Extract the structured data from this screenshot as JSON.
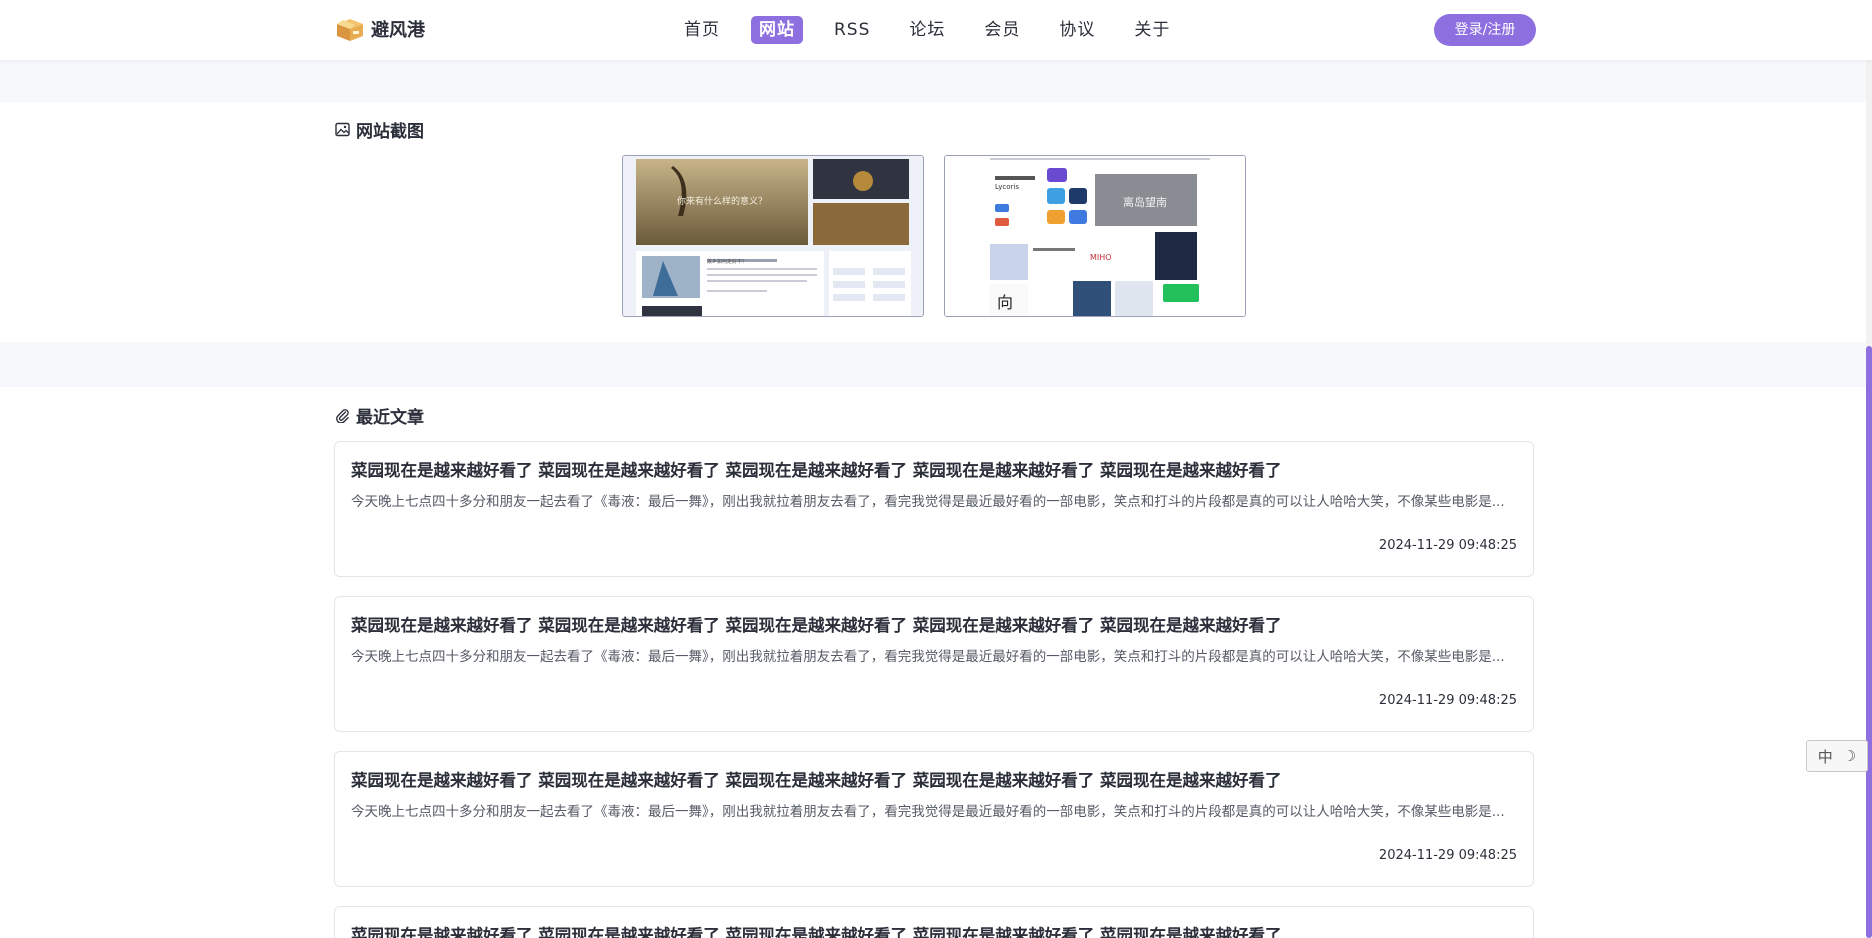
{
  "header": {
    "logo_text": "避风港",
    "nav": [
      {
        "label": "首页",
        "active": false
      },
      {
        "label": "网站",
        "active": true
      },
      {
        "label": "RSS",
        "active": false
      },
      {
        "label": "论坛",
        "active": false
      },
      {
        "label": "会员",
        "active": false
      },
      {
        "label": "协议",
        "active": false
      },
      {
        "label": "关于",
        "active": false
      }
    ],
    "login_label": "登录/注册"
  },
  "screenshots": {
    "title": "网站截图",
    "shot1": {
      "banner_text": "你来有什么样的意义？",
      "mid_title": "故乡如何走好不？"
    },
    "shot2": {
      "site_name": "Lycoris",
      "banner_text": "离岛望南",
      "tag_text": "MIHO"
    }
  },
  "articles": {
    "title": "最近文章",
    "items": [
      {
        "title": "菜园现在是越来越好看了 菜园现在是越来越好看了 菜园现在是越来越好看了 菜园现在是越来越好看了 菜园现在是越来越好看了",
        "excerpt": "今天晚上七点四十多分和朋友一起去看了《毒液：最后一舞》，刚出我就拉着朋友去看了，看完我觉得是最近最好看的一部电影，笑点和打斗的片段都是真的可以让人哈哈大笑，不像某些电影是...",
        "date": "2024-11-29 09:48:25"
      },
      {
        "title": "菜园现在是越来越好看了 菜园现在是越来越好看了 菜园现在是越来越好看了 菜园现在是越来越好看了 菜园现在是越来越好看了",
        "excerpt": "今天晚上七点四十多分和朋友一起去看了《毒液：最后一舞》，刚出我就拉着朋友去看了，看完我觉得是最近最好看的一部电影，笑点和打斗的片段都是真的可以让人哈哈大笑，不像某些电影是...",
        "date": "2024-11-29 09:48:25"
      },
      {
        "title": "菜园现在是越来越好看了 菜园现在是越来越好看了 菜园现在是越来越好看了 菜园现在是越来越好看了 菜园现在是越来越好看了",
        "excerpt": "今天晚上七点四十多分和朋友一起去看了《毒液：最后一舞》，刚出我就拉着朋友去看了，看完我觉得是最近最好看的一部电影，笑点和打斗的片段都是真的可以让人哈哈大笑，不像某些电影是...",
        "date": "2024-11-29 09:48:25"
      },
      {
        "title": "菜园现在是越来越好看了 菜园现在是越来越好看了 菜园现在是越来越好看了 菜园现在是越来越好看了 菜园现在是越来越好看了"
      }
    ]
  },
  "ime": {
    "mode_label": "中",
    "moon_glyph": "☽"
  },
  "colors": {
    "accent": "#8e6fe0",
    "band": "#f7f8fc",
    "text": "#2b2f3a"
  }
}
